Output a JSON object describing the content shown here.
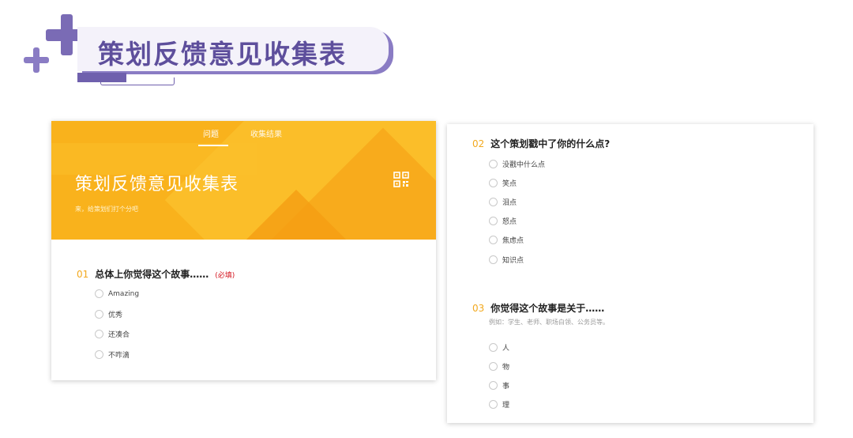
{
  "banner": {
    "title": "策划反馈意见收集表"
  },
  "form": {
    "tabs": [
      "问题",
      "收集结果"
    ],
    "title": "策划反馈意见收集表",
    "subtitle": "来，给策划们打个分吧"
  },
  "questions": [
    {
      "number": "01",
      "text": "总体上你觉得这个故事……",
      "required": "(必填)",
      "options": [
        "Amazing",
        "优秀",
        "还凑合",
        "不咋滴"
      ]
    },
    {
      "number": "02",
      "text": "这个策划戳中了你的什么点?",
      "options": [
        "没戳中什么点",
        "笑点",
        "泪点",
        "怒点",
        "焦虑点",
        "知识点"
      ]
    },
    {
      "number": "03",
      "text": "你觉得这个故事是关于……",
      "hint": "例如：学生、老师、职场白领、公务员等。",
      "options": [
        "人",
        "物",
        "事",
        "理"
      ]
    }
  ],
  "colors": {
    "brand_purple": "#5e4f9c",
    "header_orange": "#f9b21c",
    "question_number": "#f2a91f",
    "required_red": "#d4141e"
  },
  "icons": {
    "plus": "plus-icon",
    "qr": "qr-code-icon",
    "radio": "radio-button-icon"
  }
}
